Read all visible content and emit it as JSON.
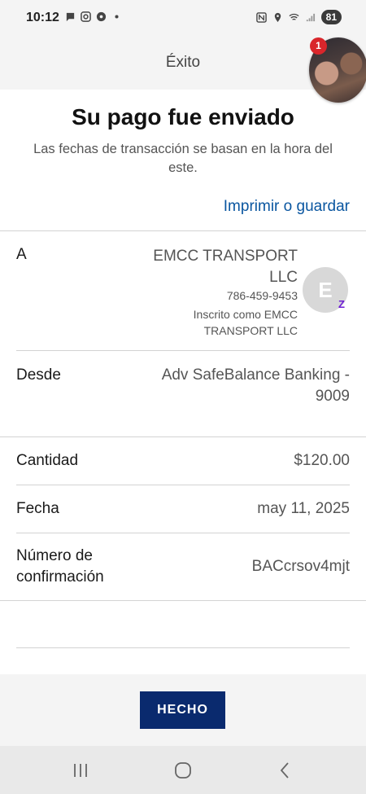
{
  "status_bar": {
    "time": "10:12",
    "battery": "81"
  },
  "header": {
    "title": "Éxito",
    "notification_count": "1"
  },
  "success": {
    "title": "Su pago fue enviado",
    "subtitle": "Las fechas de transacción se basan en la hora del este.",
    "print_link": "Imprimir o guardar"
  },
  "recipient": {
    "label": "A",
    "name": "EMCC TRANSPORT LLC",
    "phone": "786-459-9453",
    "enrolled_as": "Inscrito como EMCC TRANSPORT LLC",
    "avatar_initial": "E"
  },
  "from": {
    "label": "Desde",
    "value": "Adv SafeBalance Banking - 9009"
  },
  "amount": {
    "label": "Cantidad",
    "value": "$120.00"
  },
  "date": {
    "label": "Fecha",
    "value": "may 11, 2025"
  },
  "confirmation": {
    "label": "Número de confirmación",
    "value": "BACcrsov4mjt"
  },
  "done_button": {
    "label": "HECHO"
  },
  "icons": {
    "zelle": "zelle-icon",
    "nav_recent": "recent-apps-icon",
    "nav_home": "home-icon",
    "nav_back": "back-icon"
  },
  "colors": {
    "link": "#0a56a0",
    "primary_button": "#0a2a6e",
    "badge": "#d9262b"
  }
}
